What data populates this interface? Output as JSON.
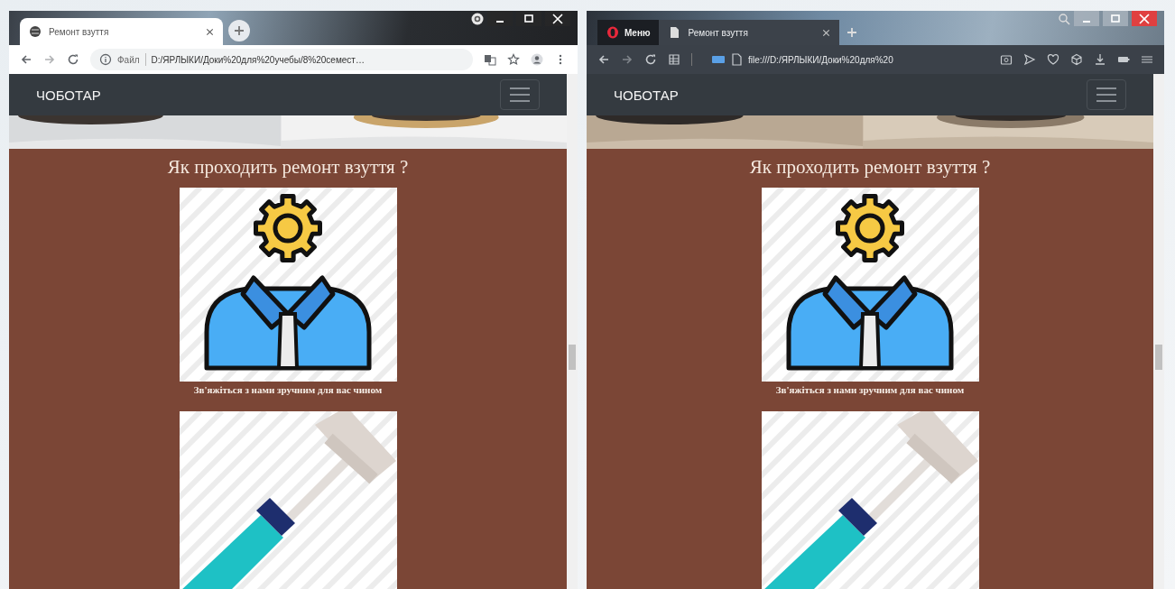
{
  "windows": [
    {
      "kind": "chrome",
      "tabs": [
        {
          "title": "Ремонт взуття",
          "selected": true
        }
      ],
      "address": {
        "prefix": "Файл",
        "url": "D:/ЯРЛЫКИ/Доки%20для%20учебы/8%20семест…"
      },
      "page": {
        "brand": "ЧОБОТАР",
        "heading": "Як проходить ремонт взуття ?",
        "cards": [
          {
            "kind": "gear-person",
            "caption": "Зв'яжіться з нами зручним для вас чином"
          },
          {
            "kind": "hammer"
          }
        ]
      }
    },
    {
      "kind": "opera",
      "menu_button": "Меню",
      "tabs": [
        {
          "title": "Ремонт взуття",
          "selected": true
        }
      ],
      "address": {
        "url": "file:///D:/ЯРЛЫКИ/Доки%20для%20"
      },
      "page": {
        "brand": "ЧОБОТАР",
        "heading": "Як проходить ремонт взуття ?",
        "cards": [
          {
            "kind": "gear-person",
            "caption": "Зв'яжіться з нами зручним для вас чином"
          },
          {
            "kind": "hammer"
          }
        ]
      }
    }
  ]
}
